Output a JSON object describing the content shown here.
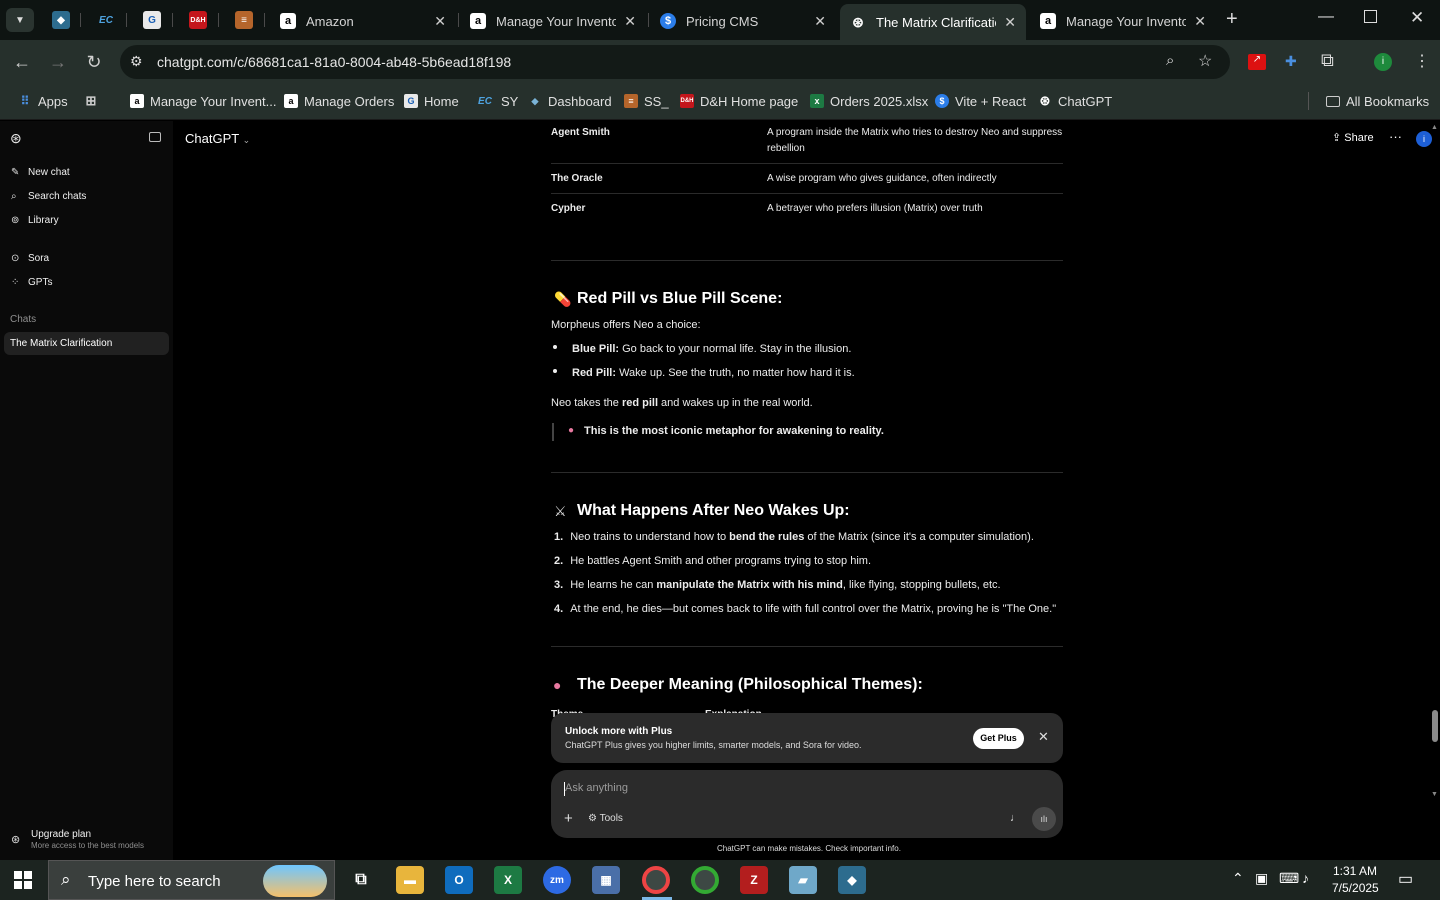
{
  "browser": {
    "tabs": [
      {
        "title": "Amazon",
        "icon": "amazon-icon"
      },
      {
        "title": "Manage Your Inventor",
        "icon": "amazon-icon"
      },
      {
        "title": "Pricing CMS",
        "icon": "dollar-icon"
      },
      {
        "title": "The Matrix Clarificatio",
        "icon": "chatgpt-icon",
        "active": true
      },
      {
        "title": "Manage Your Inventor",
        "icon": "amazon-icon"
      }
    ],
    "url": "chatgpt.com/c/68681ca1-81a0-8004-ab48-5b6ead18f198",
    "bookmarks": [
      {
        "label": "Apps"
      },
      {
        "label": "Manage Your Invent..."
      },
      {
        "label": "Manage Orders"
      },
      {
        "label": "Home"
      },
      {
        "label": "SY"
      },
      {
        "label": "Dashboard"
      },
      {
        "label": "SS_"
      },
      {
        "label": "D&H Home page"
      },
      {
        "label": "Orders 2025.xlsx"
      },
      {
        "label": "Vite + React"
      },
      {
        "label": "ChatGPT"
      }
    ],
    "all_bookmarks": "All Bookmarks",
    "profile_initial": "i"
  },
  "sidebar": {
    "new_chat": "New chat",
    "search_chats": "Search chats",
    "library": "Library",
    "sora": "Sora",
    "gpts": "GPTs",
    "chats_heading": "Chats",
    "active_chat": "The Matrix Clarification",
    "upgrade_title": "Upgrade plan",
    "upgrade_sub": "More access to the best models"
  },
  "header": {
    "model": "ChatGPT",
    "share": "Share",
    "more": "···"
  },
  "content": {
    "characters": [
      {
        "name": "Agent Smith",
        "desc_line1": "A program inside the Matrix who tries to destroy Neo and suppress",
        "desc_line2": "rebellion"
      },
      {
        "name": "The Oracle",
        "desc_line1": "A wise program who gives guidance, often indirectly",
        "desc_line2": ""
      },
      {
        "name": "Cypher",
        "desc_line1": "A betrayer who prefers illusion (Matrix) over truth",
        "desc_line2": ""
      }
    ],
    "pill_heading": "Red Pill vs Blue Pill Scene:",
    "pill_intro": "Morpheus offers Neo a choice:",
    "blue_pill_label": "Blue Pill:",
    "blue_pill_text": "Go back to your normal life. Stay in the illusion.",
    "red_pill_label": "Red Pill:",
    "red_pill_text": "Wake up. See the truth, no matter how hard it is.",
    "neo_takes_pre": "Neo takes the ",
    "neo_takes_bold": "red pill",
    "neo_takes_post": " and wakes up in the real world.",
    "quote": "This is the most iconic metaphor for awakening to reality.",
    "after_heading": "What Happens After Neo Wakes Up:",
    "after_items": [
      {
        "num": "1.",
        "pre": "Neo trains to understand how to ",
        "bold": "bend the rules",
        "post": " of the Matrix (since it's a computer simulation)."
      },
      {
        "num": "2.",
        "pre": "He battles Agent Smith and other programs trying to stop him.",
        "bold": "",
        "post": ""
      },
      {
        "num": "3.",
        "pre": "He learns he can ",
        "bold": "manipulate the Matrix with his mind",
        "post": ", like flying, stopping bullets, etc."
      },
      {
        "num": "4.",
        "pre": "At the end, he dies—but comes back to life with full control over the Matrix, proving he is \"The One.\"",
        "bold": "",
        "post": ""
      }
    ],
    "deeper_heading": "The Deeper Meaning (Philosophical Themes):",
    "table_col1": "Theme",
    "table_col2": "Explanation"
  },
  "plus_banner": {
    "title": "Unlock more with Plus",
    "subtitle": "ChatGPT Plus gives you higher limits, smarter models, and Sora for video.",
    "button": "Get Plus"
  },
  "composer": {
    "placeholder": "Ask anything",
    "tools": "Tools",
    "disclaimer": "ChatGPT can make mistakes. Check important info."
  },
  "taskbar": {
    "search_placeholder": "Type here to search",
    "time": "1:31 AM",
    "date": "7/5/2025"
  }
}
